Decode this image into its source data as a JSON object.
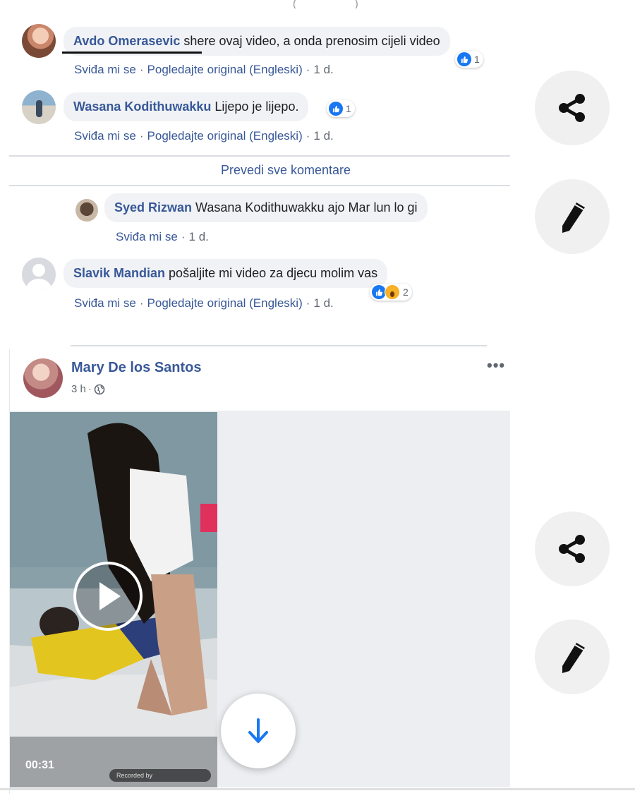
{
  "comments": [
    {
      "author": "Avdo Omerasevic",
      "text": "shere ovaj video, a onda prenosim cijeli video",
      "reactions": "1",
      "actions": {
        "like": "Sviđa mi se",
        "original": "Pogledajte original (Engleski)",
        "time": "1 d."
      }
    },
    {
      "author": "Wasana Kodithuwakku",
      "text": "Lijepo je lijepo.",
      "reactions": "1",
      "actions": {
        "like": "Sviđa mi se",
        "original": "Pogledajte original (Engleski)",
        "time": "1 d."
      }
    },
    {
      "author": "Syed Rizwan",
      "text": "Wasana Kodithuwakku ajo Mar lun lo gi",
      "actions": {
        "like": "Sviđa mi se",
        "time": "1 d."
      }
    },
    {
      "author": "Slavik Mandian",
      "text": "pošaljite mi video za djecu molim vas",
      "reactions": "2",
      "actions": {
        "like": "Sviđa mi se",
        "original": "Pogledajte original (Engleski)",
        "time": "1 d."
      }
    }
  ],
  "translate_all": "Prevedi sve komentare",
  "post": {
    "author": "Mary De los Santos",
    "time": "3 h",
    "more": "•••",
    "video": {
      "duration": "00:31",
      "recorded": "Recorded by"
    }
  },
  "colors": {
    "link": "#385898",
    "like": "#1877f2",
    "bubble": "#f0f2f5"
  },
  "icons": [
    "share-icon",
    "pencil-icon",
    "play-icon",
    "arrow-down-icon",
    "globe-icon",
    "like-icon",
    "wow-icon"
  ]
}
